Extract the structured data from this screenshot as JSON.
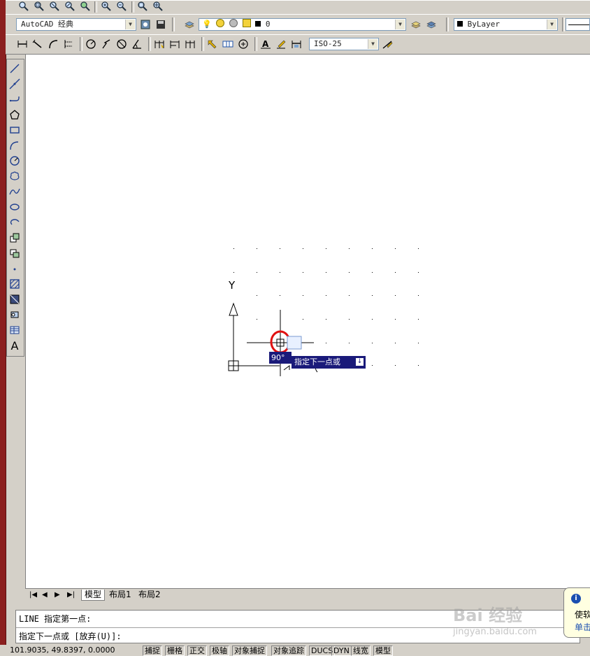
{
  "toolbar_top": {
    "icons": [
      "zoom-realtime-icon",
      "zoom-window-icon",
      "zoom-dynamic-icon",
      "zoom-scale-icon",
      "zoom-center-icon",
      "zoom-in-icon",
      "zoom-out-icon",
      "zoom-all-icon",
      "zoom-extents-icon"
    ]
  },
  "workspace": {
    "value": "AutoCAD 经典"
  },
  "layer": {
    "value": "0"
  },
  "color_combo": {
    "value": "ByLayer"
  },
  "dim_toolbar": {
    "dimstyle_value": "ISO-25"
  },
  "draw_toolbar": {
    "items": [
      "line-icon",
      "construction-line-icon",
      "polyline-icon",
      "polygon-icon",
      "rectangle-icon",
      "arc-icon",
      "circle-icon",
      "revision-cloud-icon",
      "spline-icon",
      "ellipse-icon",
      "ellipse-arc-icon",
      "insert-block-icon",
      "make-block-icon",
      "point-icon",
      "hatch-icon",
      "gradient-icon",
      "region-icon",
      "table-icon"
    ],
    "text_label": "A"
  },
  "canvas": {
    "ucs_y_label": "Y",
    "angle_tooltip": "90°",
    "dynamic_prompt": "指定下一点或",
    "dynamic_prompt_icon": "↓"
  },
  "tabs": {
    "nav": [
      "|◀",
      "◀",
      "▶",
      "▶|"
    ],
    "items": [
      "模型",
      "布局1",
      "布局2"
    ]
  },
  "command": {
    "line1": "LINE 指定第一点:",
    "line2": "指定下一点或 [放弃(U)]:"
  },
  "status_bar": {
    "coords": "101.9035,  49.8397,  0.0000",
    "buttons": [
      "捕捉",
      "栅格",
      "正交",
      "极轴",
      "对象捕捉",
      "对象追踪",
      "DUCS",
      "DYN",
      "线宽",
      "模型"
    ]
  },
  "balloon": {
    "line1": "i",
    "line2": "使软",
    "line3": "单击"
  },
  "watermark": {
    "brand": "Bai 经验",
    "url": "jingyan.baidu.com"
  }
}
